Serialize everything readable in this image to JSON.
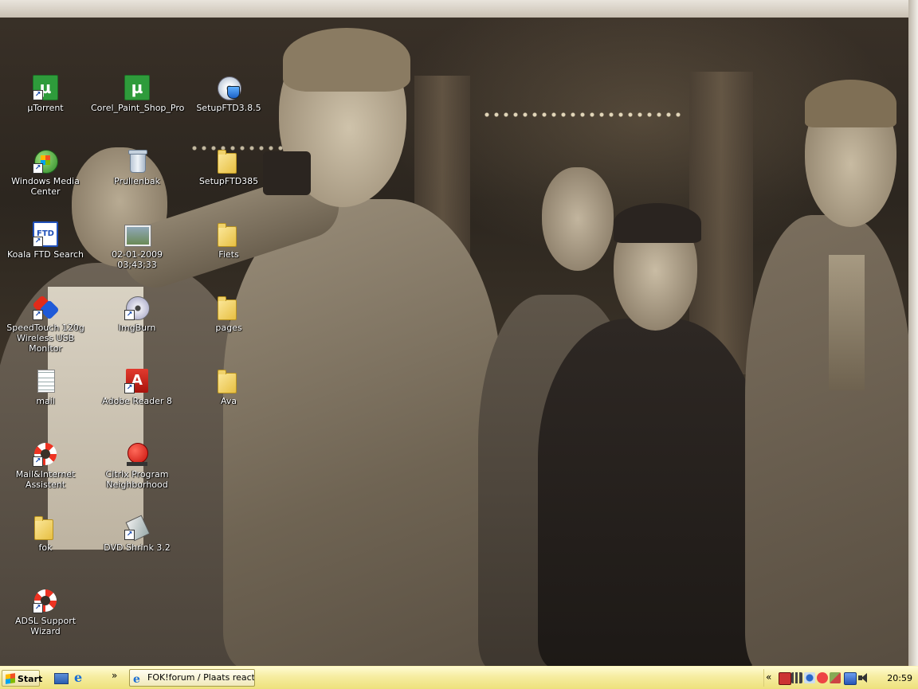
{
  "desktop": {
    "icons": [
      {
        "label": "µTorrent",
        "icon": "utorrent-icon"
      },
      {
        "label": "Corel_Paint_Shop_Pro",
        "icon": "utorrent-icon"
      },
      {
        "label": "SetupFTD3.8.5",
        "icon": "setup-disc-icon"
      },
      {
        "label": "Windows Media Center",
        "icon": "media-center-icon"
      },
      {
        "label": "Prullenbak",
        "icon": "recycle-bin-icon"
      },
      {
        "label": "SetupFTD385",
        "icon": "folder-icon"
      },
      {
        "label": "Koala FTD Search",
        "icon": "ftd-search-icon"
      },
      {
        "label": "02-01-2009 03;43;33",
        "icon": "photo-icon"
      },
      {
        "label": "Fiets",
        "icon": "folder-icon"
      },
      {
        "label": "SpeedTouch 120g\nWireless USB Monitor",
        "icon": "speedtouch-icon"
      },
      {
        "label": "ImgBurn",
        "icon": "imgburn-icon"
      },
      {
        "label": "pages",
        "icon": "folder-icon"
      },
      {
        "label": "mail",
        "icon": "text-document-icon"
      },
      {
        "label": "Adobe Reader 8",
        "icon": "adobe-reader-icon"
      },
      {
        "label": "Ava",
        "icon": "folder-icon"
      },
      {
        "label": "Mail&Internet Assistent",
        "icon": "lifebuoy-icon"
      },
      {
        "label": "Citrix Program\nNeighborhood",
        "icon": "citrix-icon"
      },
      {
        "label": "fok",
        "icon": "folder-icon"
      },
      {
        "label": "DVD Shrink 3.2",
        "icon": "dvd-shrink-icon"
      },
      {
        "label": "ADSL Support Wizard",
        "icon": "lifebuoy-icon"
      }
    ]
  },
  "taskbar": {
    "start_label": "Start",
    "overflow_label": "»",
    "tray_expand_label": "«",
    "task_label": "FOK!forum / Plaats reacti...",
    "clock": "20:59"
  },
  "colors": {
    "taskbar_top": "#fffbd2",
    "taskbar_bottom": "#ede17c",
    "icon_label_text": "#ffffff"
  }
}
